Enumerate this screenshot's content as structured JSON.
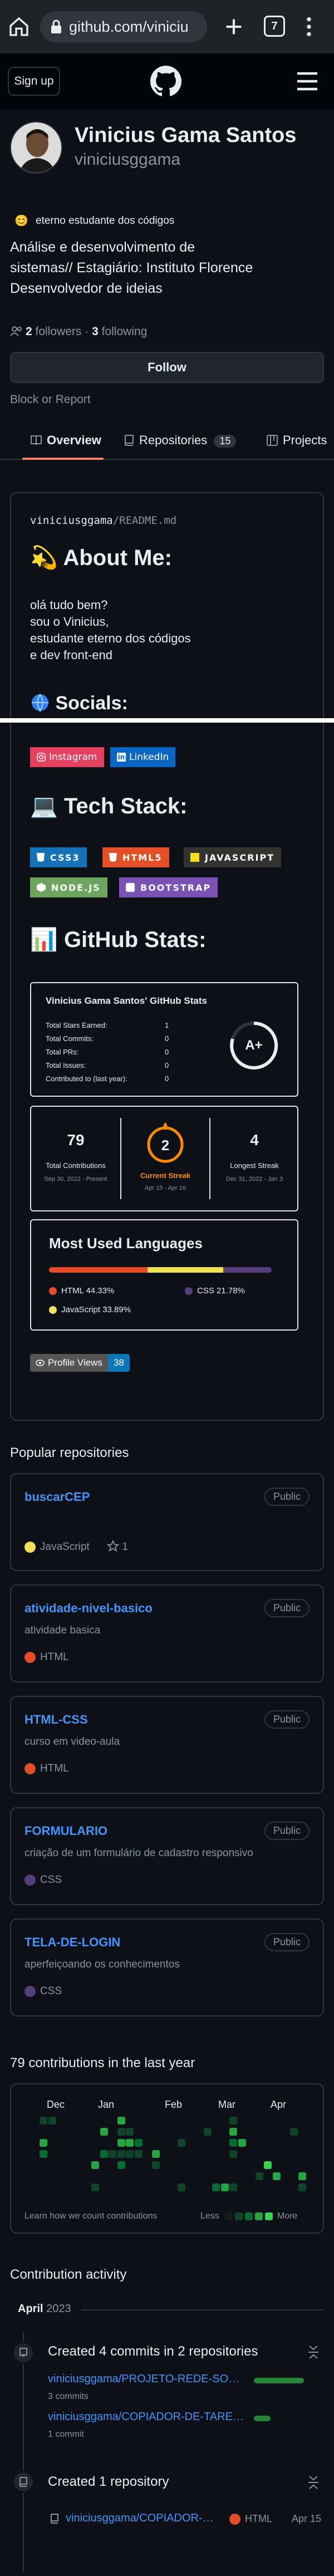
{
  "browser": {
    "url": "github.com/viniciu",
    "tab_count": "7"
  },
  "nav": {
    "signup": "Sign up"
  },
  "profile": {
    "name": "Vinicius Gama Santos",
    "username": "viniciusggama",
    "status_emoji": "😊",
    "status": "eterno estudante dos códigos",
    "bio": "Análise e desenvolvimento de sistemas// Estagiário: Instituto Florence Desenvolvedor de ideias",
    "followers_count": "2",
    "followers_label": "followers",
    "following_count": "3",
    "following_label": "following",
    "follow_button": "Follow",
    "block_report": "Block or Report"
  },
  "tabs": [
    {
      "label": "Overview"
    },
    {
      "label": "Repositories",
      "count": "15"
    },
    {
      "label": "Projects"
    }
  ],
  "readme": {
    "path_user": "viniciusggama",
    "path_sep": "/",
    "path_file": "README.md",
    "about_heading": "About Me:",
    "about_emoji": "💫",
    "about_lines": [
      "olá tudo bem?",
      "sou o Vinicius,",
      "estudante eterno dos códigos",
      "e dev front-end"
    ],
    "socials_heading": "Socials:",
    "socials_badges": [
      "Instagram",
      "LinkedIn"
    ],
    "tech_heading": "Tech Stack:",
    "tech_emoji": "💻",
    "tech_badges": [
      "CSS3",
      "HTML5",
      "JAVASCRIPT",
      "NODE.JS",
      "BOOTSTRAP"
    ],
    "stats_heading": "GitHub Stats:",
    "stats_emoji": "📊",
    "stats_card": {
      "title": "Vinicius Gama Santos' GitHub Stats",
      "rows": [
        {
          "label": "Total Stars Earned:",
          "value": "1"
        },
        {
          "label": "Total Commits:",
          "value": "0"
        },
        {
          "label": "Total PRs:",
          "value": "0"
        },
        {
          "label": "Total Issues:",
          "value": "0"
        },
        {
          "label": "Contributed to (last year):",
          "value": "0"
        }
      ],
      "grade": "A+"
    },
    "streak": {
      "total_value": "79",
      "total_label": "Total Contributions",
      "total_range": "Sep 30, 2022 - Present",
      "current_value": "2",
      "current_label": "Current Streak",
      "current_range": "Apr 15 - Apr 16",
      "longest_value": "4",
      "longest_label": "Longest Streak",
      "longest_range": "Dec 31, 2022 - Jan 3"
    },
    "languages": {
      "title": "Most Used Languages",
      "items": [
        {
          "name": "HTML",
          "pct": "44.33%",
          "value": 44.33,
          "color": "#e34c26"
        },
        {
          "name": "CSS",
          "pct": "21.78%",
          "value": 21.78,
          "color": "#563d7c"
        },
        {
          "name": "JavaScript",
          "pct": "33.89%",
          "value": 33.89,
          "color": "#f1e05a"
        }
      ]
    },
    "profile_views_label": "Profile Views",
    "profile_views_value": "38"
  },
  "popular": {
    "heading": "Popular repositories",
    "repos": [
      {
        "name": "buscarCEP",
        "badge": "Public",
        "desc": "",
        "lang": "JavaScript",
        "lang_color": "#f1e05a",
        "stars": "1"
      },
      {
        "name": "atividade-nivel-basico",
        "badge": "Public",
        "desc": "atividade basica",
        "lang": "HTML",
        "lang_color": "#e34c26",
        "stars": ""
      },
      {
        "name": "HTML-CSS",
        "badge": "Public",
        "desc": "curso em video-aula",
        "lang": "HTML",
        "lang_color": "#e34c26",
        "stars": ""
      },
      {
        "name": "FORMULARIO",
        "badge": "Public",
        "desc": "criação de um formulário de cadastro responsivo",
        "lang": "CSS",
        "lang_color": "#563d7c",
        "stars": ""
      },
      {
        "name": "TELA-DE-LOGIN",
        "badge": "Public",
        "desc": "aperfeiçoando os conhecimentos",
        "lang": "CSS",
        "lang_color": "#563d7c",
        "stars": ""
      }
    ]
  },
  "contrib": {
    "heading": "79 contributions in the last year",
    "months": [
      "Dec",
      "Jan",
      "Feb",
      "Mar",
      "Apr"
    ],
    "learn_link": "Learn how we count contributions",
    "less": "Less",
    "more": "More"
  },
  "activity": {
    "heading": "Contribution activity",
    "month": "April",
    "year": "2023",
    "commits_title": "Created 4 commits in 2 repositories",
    "commit_repos": [
      {
        "name": "viniciusggama/PROJETO-REDE-SO…",
        "count": "3 commits",
        "bar": 0.75
      },
      {
        "name": "viniciusggama/COPIADOR-DE-TARE…",
        "count": "1 commit",
        "bar": 0.25
      }
    ],
    "created_title": "Created 1 repository",
    "created_repo": "viniciusggama/COPIADOR-…",
    "created_lang": "HTML",
    "created_lang_color": "#e34c26",
    "created_date": "Apr 15"
  }
}
